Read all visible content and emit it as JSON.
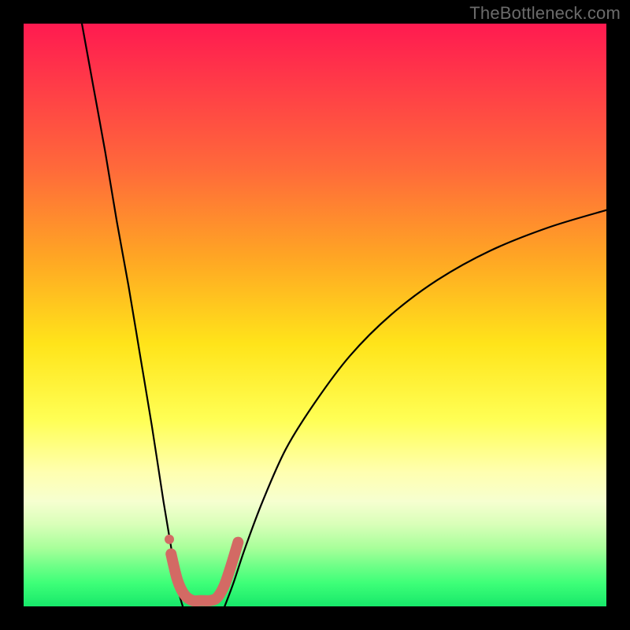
{
  "watermark": "TheBottleneck.com",
  "chart_data": {
    "type": "line",
    "title": "",
    "xlabel": "",
    "ylabel": "",
    "xlim": [
      0,
      100
    ],
    "ylim": [
      0,
      100
    ],
    "grid": false,
    "note": "Axes have no tick labels; values are relative percentages of plot width/height estimated from the image. y=0 is bottom (green), y=100 is top (red).",
    "series": [
      {
        "name": "left-curve",
        "stroke": "#000000",
        "x": [
          10,
          12,
          14,
          16,
          18,
          20,
          22,
          24,
          25.5,
          26.5,
          27.3
        ],
        "y": [
          100,
          89,
          78,
          66,
          55,
          43,
          31,
          18,
          9,
          3,
          0
        ]
      },
      {
        "name": "right-curve",
        "stroke": "#000000",
        "x": [
          34.5,
          36,
          38,
          41,
          45,
          50,
          56,
          63,
          71,
          80,
          90,
          100
        ],
        "y": [
          0,
          4,
          10,
          18,
          27,
          35,
          43,
          50,
          56,
          61,
          65,
          68
        ]
      },
      {
        "name": "highlight-segment",
        "stroke": "#d36a64",
        "stroke_width": 14,
        "x": [
          25.3,
          26.4,
          27.6,
          29.0,
          30.5,
          32.0,
          33.2,
          34.4,
          35.6,
          36.8
        ],
        "y": [
          9.0,
          4.5,
          2.0,
          1.0,
          1.0,
          1.0,
          1.5,
          3.5,
          7.0,
          11.0
        ]
      }
    ],
    "markers": [
      {
        "name": "left-dot",
        "x": 25.0,
        "y": 11.5,
        "r": 6,
        "fill": "#d36a64"
      }
    ],
    "background_gradient": {
      "direction": "top-to-bottom",
      "stops": [
        {
          "pos": 0.0,
          "color": "#ff1a50"
        },
        {
          "pos": 0.55,
          "color": "#ffe41a"
        },
        {
          "pos": 0.82,
          "color": "#f6ffd0"
        },
        {
          "pos": 1.0,
          "color": "#17e86a"
        }
      ]
    }
  }
}
